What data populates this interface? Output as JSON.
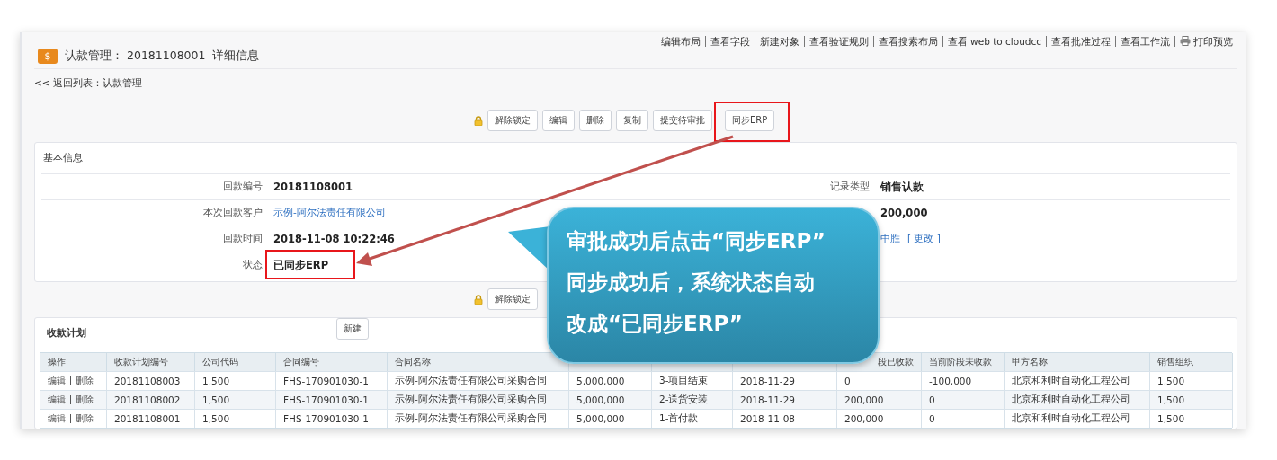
{
  "top_links": [
    {
      "label": "编辑布局"
    },
    {
      "label": "查看字段"
    },
    {
      "label": "新建对象"
    },
    {
      "label": "查看验证规则"
    },
    {
      "label": "查看搜索布局"
    },
    {
      "label": "查看 web to cloudcc"
    },
    {
      "label": "查看批准过程"
    },
    {
      "label": "查看工作流"
    },
    {
      "label": "打印预览",
      "kind": "print"
    }
  ],
  "header": {
    "icon_glyph": "$",
    "title": "认款管理： 20181108001  详细信息"
  },
  "back_link": "<< 返回列表：认款管理",
  "actions": {
    "buttons": [
      {
        "label": "解除锁定",
        "highlighted": false
      },
      {
        "label": "编辑",
        "highlighted": false
      },
      {
        "label": "删除",
        "highlighted": false
      },
      {
        "label": "复制",
        "highlighted": false
      },
      {
        "label": "提交待审批",
        "highlighted": false
      },
      {
        "label": "同步ERP",
        "highlighted": true
      }
    ]
  },
  "basic_info": {
    "title": "基本信息",
    "rows": [
      {
        "left": {
          "label": "回款编号",
          "value": "20181108001",
          "kind": "bold"
        },
        "right": {
          "label": "记录类型",
          "value": "销售认款",
          "kind": "bold"
        },
        "highlighted": false
      },
      {
        "left": {
          "label": "本次回款客户",
          "value": "示例-阿尔法责任有限公司",
          "kind": "link"
        },
        "right": {
          "value": "200,000",
          "kind": "bold"
        },
        "highlighted": false
      },
      {
        "left": {
          "label": "回款时间",
          "value": "2018-11-08 10:22:46",
          "kind": "bold"
        },
        "right": {
          "value": "中胜",
          "kind": "link",
          "action": "[ 更改 ]"
        },
        "highlighted": false
      },
      {
        "left": {
          "label": "状态",
          "value": "已同步ERP",
          "kind": "bold"
        },
        "highlighted": true
      }
    ]
  },
  "bottom_actions": {
    "buttons": [
      {
        "label": "解除锁定"
      }
    ]
  },
  "payment_plan": {
    "title": "收款计划",
    "new_button": "新建",
    "columns": [
      "操作",
      "收款计划编号",
      "公司代码",
      "合同编号",
      "合同名称",
      null,
      null,
      null,
      "段已收款",
      "当前阶段未收款",
      "甲方名称",
      "销售组织"
    ],
    "rows": [
      {
        "cells": [
          [
            "编辑",
            "删除"
          ],
          "20181108003",
          "1,500",
          "FHS-170901030-1",
          "示例-阿尔法责任有限公司采购合同",
          "5,000,000",
          "3-项目结束",
          "2018-11-29",
          "0",
          "-100,000",
          "北京和利时自动化工程公司",
          "1,500"
        ]
      },
      {
        "cells": [
          [
            "编辑",
            "删除"
          ],
          "20181108002",
          "1,500",
          "FHS-170901030-1",
          "示例-阿尔法责任有限公司采购合同",
          "5,000,000",
          "2-送货安装",
          "2018-11-29",
          "200,000",
          "0",
          "北京和利时自动化工程公司",
          "1,500"
        ]
      },
      {
        "cells": [
          [
            "编辑",
            "删除"
          ],
          "20181108001",
          "1,500",
          "FHS-170901030-1",
          "示例-阿尔法责任有限公司采购合同",
          "5,000,000",
          "1-首付款",
          "2018-11-08",
          "200,000",
          "0",
          "北京和利时自动化工程公司",
          "1,500"
        ]
      }
    ]
  },
  "callout": {
    "lines": [
      "审批成功后点击“同步ERP”",
      "同步成功后，系统状态自动",
      "改成“已同步ERP”"
    ]
  }
}
